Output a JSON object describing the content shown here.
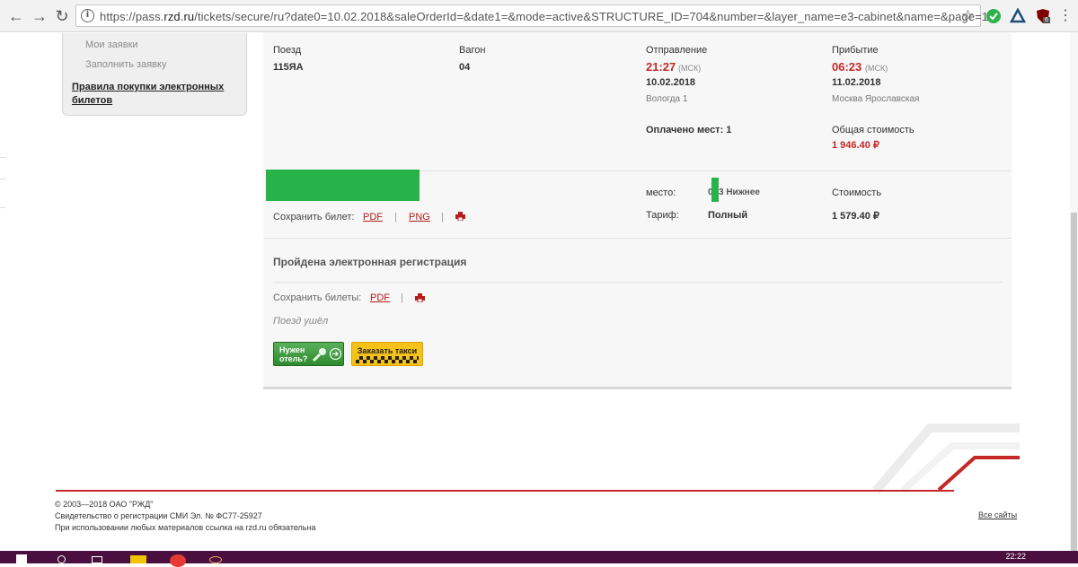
{
  "browser": {
    "url_prefix": "https://pass.",
    "url_domain": "rzd.ru",
    "url_rest": "/tickets/secure/ru?date0=10.02.2018&saleOrderId=&date1=&mode=active&STRUCTURE_ID=704&number=&layer_name=e3-cabinet&name=&page=1",
    "ext_badge": "6"
  },
  "left_menu": {
    "items": [
      "Мои заявки",
      "Заполнить заявку"
    ],
    "rules_link": "Правила покупки электронных билетов"
  },
  "order": {
    "train_label": "Поезд",
    "train": "115ЯА",
    "car_label": "Вагон",
    "car": "04",
    "departure_label": "Отправление",
    "departure_time": "21:27",
    "departure_tz": "(МСК)",
    "departure_date": "10.02.2018",
    "departure_station": "Вологда 1",
    "arrival_label": "Прибытие",
    "arrival_time": "06:23",
    "arrival_tz": "(МСК)",
    "arrival_date": "11.02.2018",
    "arrival_station": "Москва Ярославская",
    "paid_seats": "Оплачено мест: 1",
    "total_label": "Общая стоимость",
    "total_price": "1 946.40 ₽"
  },
  "ticket": {
    "save_label": "Сохранить билет:",
    "pdf": "PDF",
    "png": "PNG",
    "separator": "|",
    "seat_label": "место:",
    "seat_value_a": "0",
    "seat_value_b": "3 Нижнее",
    "tariff_label": "Тариф:",
    "tariff": "Полный",
    "cost_label": "Стоимость",
    "cost": "1 579.40 ₽"
  },
  "registration": {
    "title": "Пройдена электронная регистрация",
    "save_label": "Сохранить билеты:",
    "pdf": "PDF",
    "train_left": "Поезд ушёл"
  },
  "promo": {
    "hotel_line1": "Нужен",
    "hotel_line2": "отель?",
    "taxi": "Заказать такси"
  },
  "footer": {
    "copyright": "© 2003—2018 ОАО \"РЖД\"",
    "certificate": "Свидетельство о регистрации СМИ Эл. № ФС77-25927",
    "notice": "При использовании любых материалов ссылка на rzd.ru обязательна",
    "all_sites": "Все сайты"
  },
  "taskbar": {
    "clock": "22:22"
  },
  "colors": {
    "accent_red": "#c62828",
    "green": "#27b24a",
    "taskbar": "#4a0f3f"
  }
}
